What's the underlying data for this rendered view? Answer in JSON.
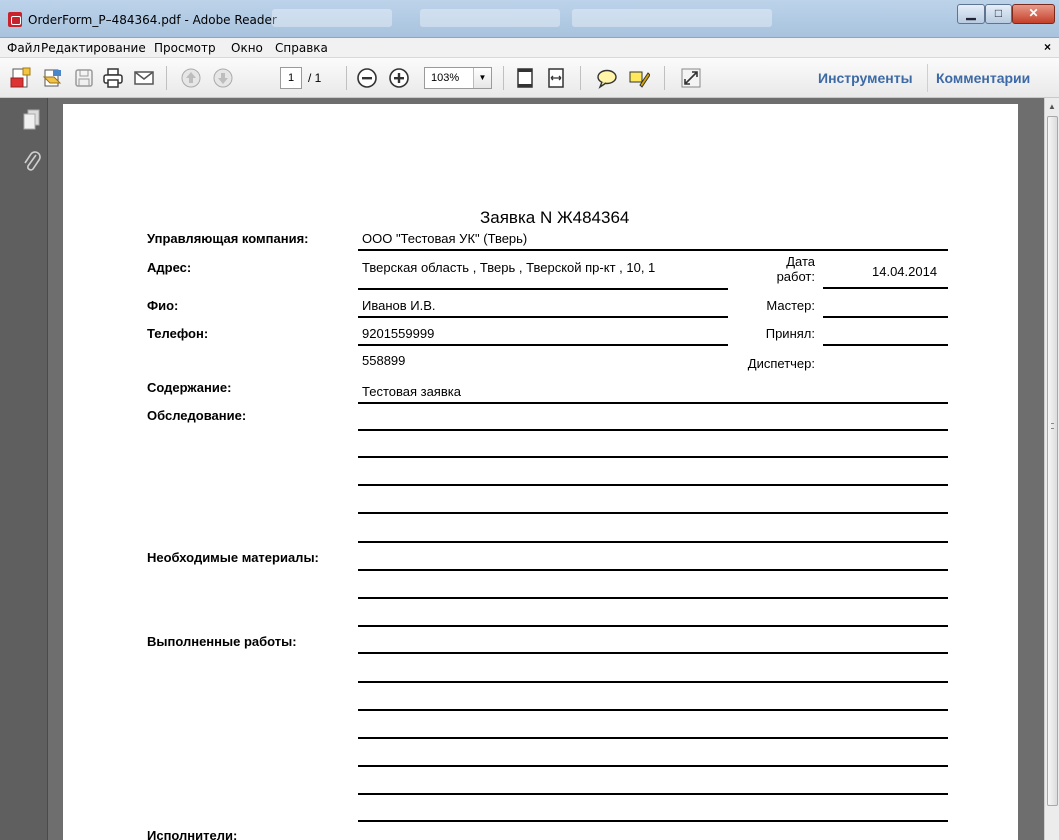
{
  "window": {
    "title": "OrderForm_P–484364.pdf - Adobe Reader",
    "buttons": {
      "minimize": "▁",
      "maximize": "□",
      "close": "✕"
    }
  },
  "menu": {
    "items": [
      "Файл",
      "Редактирование",
      "Просмотр",
      "Окно",
      "Справка"
    ],
    "close": "×"
  },
  "toolbar": {
    "page_current": "1",
    "page_total": "/ 1",
    "zoom": "103%",
    "zoom_dropdown": "▼",
    "tools": "Инструменты",
    "comments": "Комментарии",
    "icons": [
      "create-pdf-icon",
      "open-icon",
      "save-icon",
      "print-icon",
      "email-icon",
      "prev-page-icon",
      "next-page-icon",
      "zoom-out-icon",
      "zoom-in-icon",
      "fit-page-icon",
      "fit-width-icon",
      "comment-icon",
      "highlight-icon",
      "fullscreen-icon"
    ]
  },
  "form": {
    "title": "Заявка N Ж484364",
    "labels": {
      "company": "Управляющая компания:",
      "address": "Адрес:",
      "fio": "Фио:",
      "phone": "Телефон:",
      "content": "Содержание:",
      "inspection": "Обследование:",
      "materials": "Необходимые материалы:",
      "works": "Выполненные работы:",
      "executors": "Исполнители:"
    },
    "values": {
      "company": "ООО \"Тестовая УК\" (Тверь)",
      "address": "Тверская область , Тверь , Тверской пр-кт , 10, 1",
      "fio": "Иванов И.В.",
      "phone": "9201559999",
      "phone2": "558899",
      "content": "Тестовая заявка"
    },
    "right_labels": {
      "date_line1": "Дата",
      "date_line2": "работ:",
      "master": "Мастер:",
      "accepted": "Принял:",
      "dispatcher": "Диспетчер:"
    },
    "right_values": {
      "date": "14.04.2014"
    }
  }
}
